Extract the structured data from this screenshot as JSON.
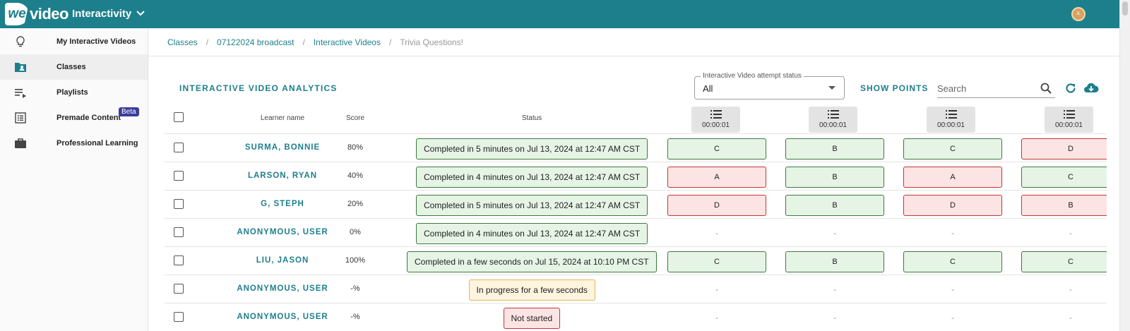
{
  "app": {
    "logo_we": "we",
    "logo_video": "video",
    "title": "Interactivity",
    "avatar_initials": "JL"
  },
  "sidebar": {
    "items": [
      {
        "label": "My Interactive Videos",
        "icon": "lightbulb-icon"
      },
      {
        "label": "Classes",
        "icon": "classes-folder-icon",
        "active": true
      },
      {
        "label": "Playlists",
        "icon": "playlist-icon"
      },
      {
        "label": "Premade Content",
        "icon": "list-box-icon",
        "badge": "Beta"
      },
      {
        "label": "Professional Learning",
        "icon": "briefcase-icon"
      }
    ]
  },
  "breadcrumb": [
    "Classes",
    "07122024 broadcast",
    "Interactive Videos",
    "Trivia Questions!"
  ],
  "toolbar": {
    "title": "INTERACTIVE VIDEO ANALYTICS",
    "status_label": "Interactive Video attempt status",
    "status_value": "All",
    "show_points": "SHOW POINTS",
    "search_placeholder": "Search"
  },
  "table": {
    "headers": {
      "learner": "Learner name",
      "score": "Score",
      "status": "Status"
    },
    "question_times": [
      "00:00:01",
      "00:00:01",
      "00:00:01",
      "00:00:01"
    ],
    "rows": [
      {
        "name": "SURMA, BONNIE",
        "score": "80%",
        "status": "Completed in 5 minutes on Jul 13, 2024 at 12:47 AM CST",
        "state": "done",
        "answers": [
          {
            "v": "C",
            "ok": true
          },
          {
            "v": "B",
            "ok": true
          },
          {
            "v": "C",
            "ok": true
          },
          {
            "v": "D",
            "ok": false
          }
        ]
      },
      {
        "name": "LARSON, RYAN",
        "score": "40%",
        "status": "Completed in 4 minutes on Jul 13, 2024 at 12:47 AM CST",
        "state": "done",
        "answers": [
          {
            "v": "A",
            "ok": false
          },
          {
            "v": "B",
            "ok": true
          },
          {
            "v": "A",
            "ok": false
          },
          {
            "v": "C",
            "ok": true
          }
        ]
      },
      {
        "name": "G, STEPH",
        "score": "20%",
        "status": "Completed in 5 minutes on Jul 13, 2024 at 12:47 AM CST",
        "state": "done",
        "answers": [
          {
            "v": "D",
            "ok": false
          },
          {
            "v": "B",
            "ok": true
          },
          {
            "v": "D",
            "ok": false
          },
          {
            "v": "B",
            "ok": false
          }
        ]
      },
      {
        "name": "ANONYMOUS, USER",
        "score": "0%",
        "status": "Completed in 4 minutes on Jul 13, 2024 at 12:47 AM CST",
        "state": "done",
        "answers": [
          {
            "v": "-",
            "ok": null
          },
          {
            "v": "-",
            "ok": null
          },
          {
            "v": "-",
            "ok": null
          },
          {
            "v": "-",
            "ok": null
          }
        ]
      },
      {
        "name": "LIU, JASON",
        "score": "100%",
        "status": "Completed in a few seconds on Jul 15, 2024 at 10:10 PM CST",
        "state": "done",
        "answers": [
          {
            "v": "C",
            "ok": true
          },
          {
            "v": "B",
            "ok": true
          },
          {
            "v": "C",
            "ok": true
          },
          {
            "v": "C",
            "ok": true
          }
        ]
      },
      {
        "name": "ANONYMOUS, USER",
        "score": "-%",
        "status": "In progress for a few seconds",
        "state": "prog",
        "answers": [
          {
            "v": "-",
            "ok": null
          },
          {
            "v": "-",
            "ok": null
          },
          {
            "v": "-",
            "ok": null
          },
          {
            "v": "-",
            "ok": null
          }
        ]
      },
      {
        "name": "ANONYMOUS, USER",
        "score": "-%",
        "status": "Not started",
        "state": "none",
        "answers": [
          {
            "v": "-",
            "ok": null
          },
          {
            "v": "-",
            "ok": null
          },
          {
            "v": "-",
            "ok": null
          },
          {
            "v": "-",
            "ok": null
          }
        ]
      }
    ]
  },
  "colors": {
    "accent": "#1d7f8c",
    "correct_bg": "#e6f4e6",
    "wrong_bg": "#fde4e4",
    "progress_bg": "#fff4de"
  }
}
